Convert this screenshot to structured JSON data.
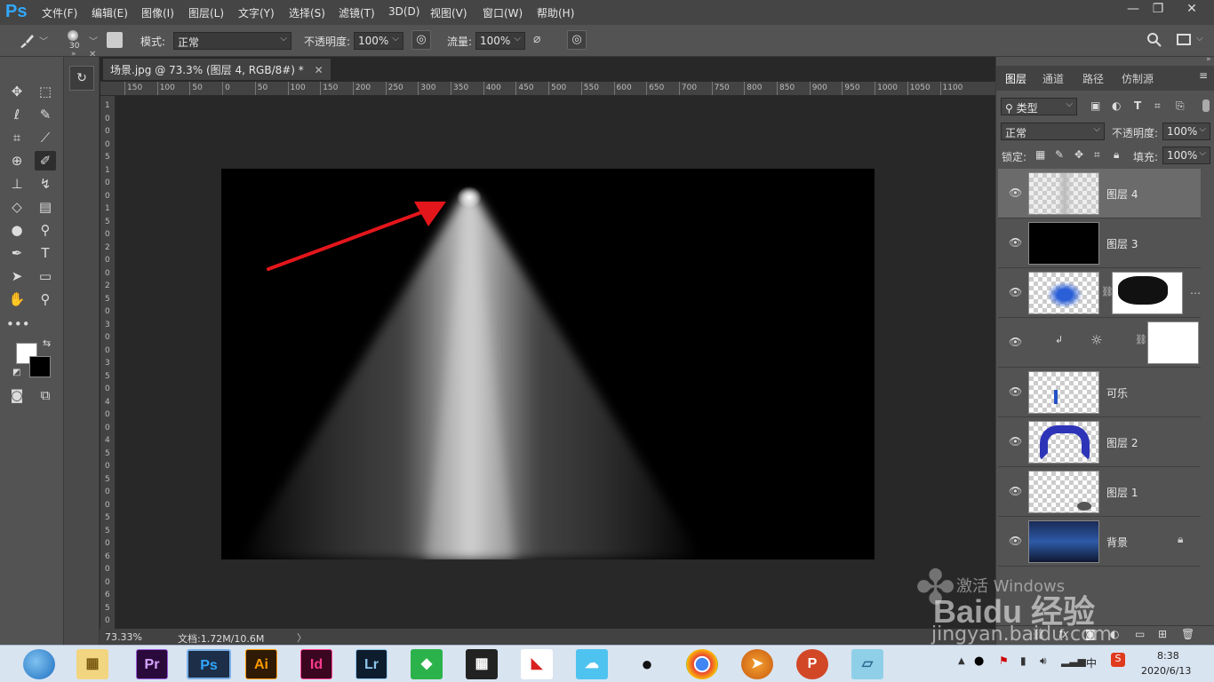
{
  "app": {
    "logo": "Ps",
    "brand_color": "#31a8ff"
  },
  "menu": [
    "文件(F)",
    "编辑(E)",
    "图像(I)",
    "图层(L)",
    "文字(Y)",
    "选择(S)",
    "滤镜(T)",
    "3D(D)",
    "视图(V)",
    "窗口(W)",
    "帮助(H)"
  ],
  "window_controls": {
    "minimize": "—",
    "restore": "❐",
    "close": "✕"
  },
  "options": {
    "brush_size": "30",
    "mode_label": "模式:",
    "mode_value": "正常",
    "opacity_label": "不透明度:",
    "opacity_value": "100%",
    "flow_label": "流量:",
    "flow_value": "100%"
  },
  "document": {
    "tab_title": "场景.jpg @ 73.3% (图层 4, RGB/8#) *",
    "zoom": "73.33%",
    "doc_size": "文档:1.72M/10.6M",
    "ruler_h": [
      "150",
      "100",
      "50",
      "0",
      "50",
      "100",
      "150",
      "200",
      "250",
      "300",
      "350",
      "400",
      "450",
      "500",
      "550",
      "600",
      "650",
      "700",
      "750",
      "800",
      "850",
      "900",
      "950",
      "1000",
      "1050",
      "1100"
    ],
    "ruler_v": [
      "1",
      "0",
      "0",
      "0",
      "5",
      "1",
      "0",
      "0",
      "1",
      "5",
      "0",
      "2",
      "0",
      "0",
      "2",
      "5",
      "0",
      "3",
      "0",
      "0",
      "3",
      "5",
      "0",
      "4",
      "0",
      "0",
      "4",
      "5",
      "0",
      "5",
      "0",
      "0",
      "5",
      "5",
      "0",
      "6",
      "0",
      "0",
      "6",
      "5",
      "0"
    ]
  },
  "layers_panel": {
    "tabs": [
      "图层",
      "通道",
      "路径",
      "仿制源"
    ],
    "filter_label": "类型",
    "blend_mode": "正常",
    "opacity_label": "不透明度:",
    "opacity_value": "100%",
    "lock_label": "锁定:",
    "fill_label": "填充:",
    "fill_value": "100%",
    "layers": [
      {
        "name": "图层 4",
        "selected": true
      },
      {
        "name": "图层 3"
      },
      {
        "name": ""
      },
      {
        "name": ""
      },
      {
        "name": "可乐"
      },
      {
        "name": "图层 2"
      },
      {
        "name": "图层 1"
      },
      {
        "name": "背景",
        "locked": true
      }
    ]
  },
  "taskbar": {
    "apps": [
      "Pr",
      "Ps",
      "Ai",
      "Id",
      "Lr"
    ],
    "time": "8:38",
    "date": "2020/6/13",
    "ime": "中"
  },
  "watermark": {
    "activate": "激活 Windows",
    "brand": "Baidu 经验",
    "url": "jingyan.baidu.com"
  }
}
